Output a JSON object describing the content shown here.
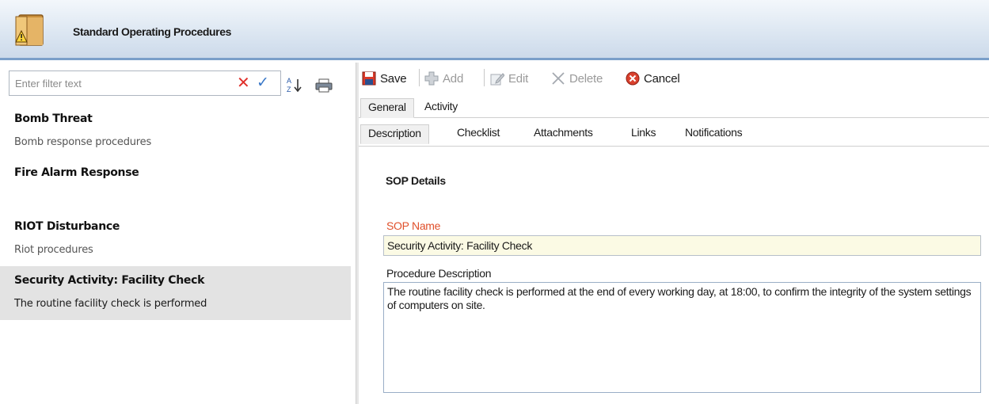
{
  "header": {
    "title": "Standard Operating Procedures",
    "icon": "sop-warning-icon"
  },
  "filter": {
    "placeholder": "Enter filter text",
    "value": ""
  },
  "list": {
    "items": [
      {
        "title": "Bomb Threat",
        "description": "Bomb response procedures"
      },
      {
        "title": "Fire Alarm Response",
        "description": ""
      },
      {
        "title": "RIOT Disturbance",
        "description": "Riot procedures"
      },
      {
        "title": "Security Activity: Facility Check",
        "description": "The routine facility check is performed"
      }
    ]
  },
  "toolbar": {
    "save": "Save",
    "add": "Add",
    "edit": "Edit",
    "delete": "Delete",
    "cancel": "Cancel"
  },
  "tabs_primary": [
    "General",
    "Activity"
  ],
  "tabs_secondary": [
    "Description",
    "Checklist",
    "Attachments",
    "Links",
    "Notifications"
  ],
  "details": {
    "heading": "SOP Details",
    "name_label": "SOP Name",
    "name_value": "Security Activity: Facility Check",
    "description_label": "Procedure Description",
    "description_value": "The routine facility check is performed at the end of every working day, at 18:00, to confirm the integrity of the system settings of computers on site."
  },
  "colors": {
    "accent": "#7a9fc9",
    "required_label": "#e0502b",
    "selected_row": "#e3e3e3",
    "name_field_bg": "#fbfae4"
  }
}
